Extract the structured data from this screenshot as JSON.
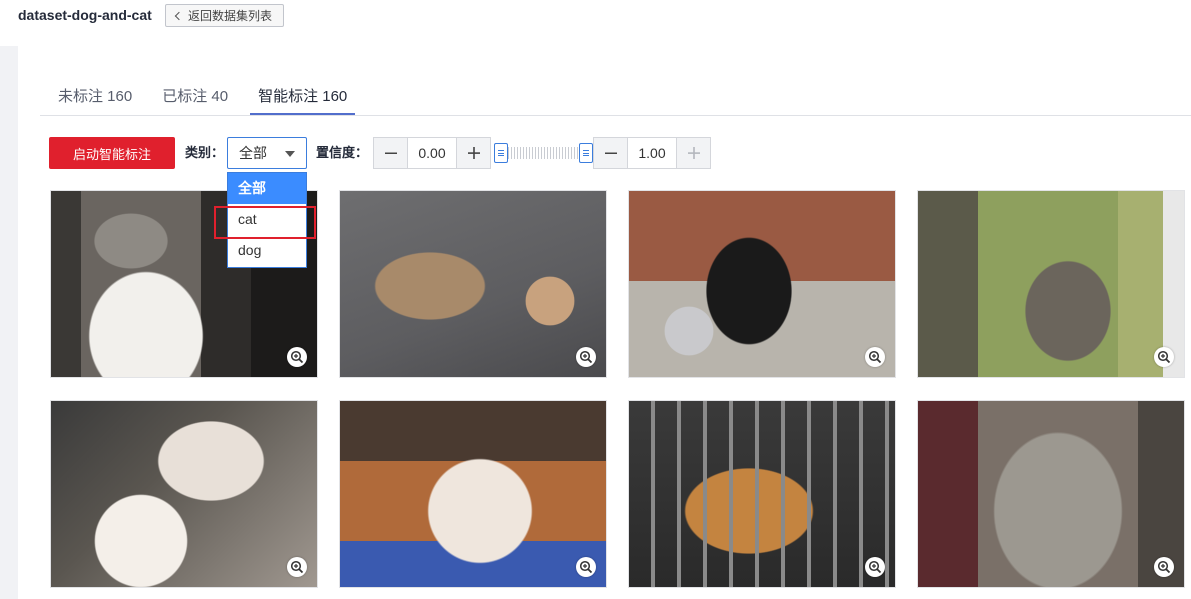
{
  "header": {
    "dataset_title": "dataset-dog-and-cat",
    "back_label": "返回数据集列表"
  },
  "tabs": [
    {
      "label": "未标注 160",
      "active": false
    },
    {
      "label": "已标注 40",
      "active": false
    },
    {
      "label": "智能标注 160",
      "active": true
    }
  ],
  "toolbar": {
    "start_label": "启动智能标注",
    "category_label": "类别：",
    "category_selected": "全部",
    "category_options": [
      "全部",
      "cat",
      "dog"
    ],
    "confidence_label": "置信度：",
    "confidence_min": "0.00",
    "confidence_max": "1.00"
  },
  "colors": {
    "primary_red": "#e0202d",
    "select_blue": "#3b8cff",
    "tab_underline": "#526ecc"
  },
  "icons": {
    "back": "chevron-left-icon",
    "dropdown": "caret-down-icon",
    "minus": "minus-icon",
    "plus": "plus-icon",
    "zoom": "zoom-in-icon"
  },
  "gallery": {
    "image_count": 8,
    "contents": [
      "cat",
      "cat",
      "dog",
      "cat",
      "cat",
      "cat",
      "cat",
      "cat"
    ]
  }
}
